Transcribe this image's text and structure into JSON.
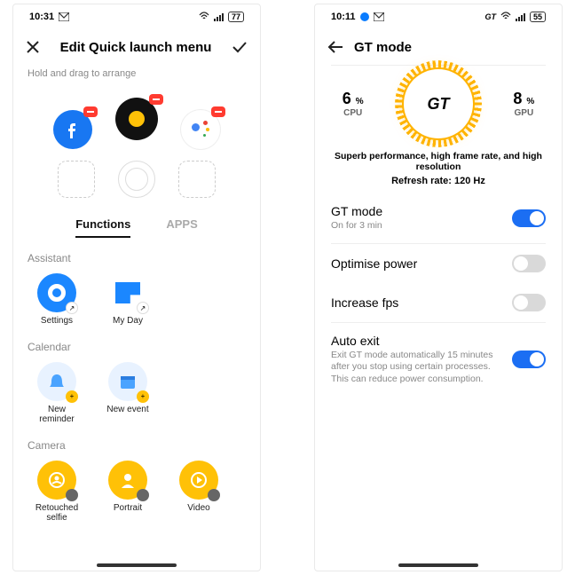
{
  "phone1": {
    "status": {
      "time": "10:31",
      "battery": "77"
    },
    "header": {
      "title": "Edit Quick launch menu"
    },
    "hint": "Hold and drag to arrange",
    "tabs": {
      "functions": "Functions",
      "apps": "APPS"
    },
    "sections": {
      "assistant": {
        "title": "Assistant",
        "items": [
          "Settings",
          "My Day"
        ]
      },
      "calendar": {
        "title": "Calendar",
        "items": [
          "New reminder",
          "New event"
        ]
      },
      "camera": {
        "title": "Camera",
        "items": [
          "Retouched selfie",
          "Portrait",
          "Video"
        ]
      }
    }
  },
  "phone2": {
    "status": {
      "time": "10:11",
      "battery": "55"
    },
    "header": {
      "title": "GT mode"
    },
    "stats": {
      "cpu_val": "6",
      "cpu_lbl": "CPU",
      "gpu_val": "8",
      "gpu_lbl": "GPU",
      "pct": "%"
    },
    "gt_label": "GT",
    "desc": "Superb performance, high frame rate, and high resolution",
    "refresh": "Refresh rate: 120 Hz",
    "rows": {
      "gt": {
        "title": "GT mode",
        "sub": "On for 3 min"
      },
      "opt": {
        "title": "Optimise power"
      },
      "fps": {
        "title": "Increase fps"
      },
      "auto": {
        "title": "Auto exit",
        "sub": "Exit GT mode automatically 15 minutes after you stop using certain processes. This can reduce power consumption."
      }
    }
  }
}
